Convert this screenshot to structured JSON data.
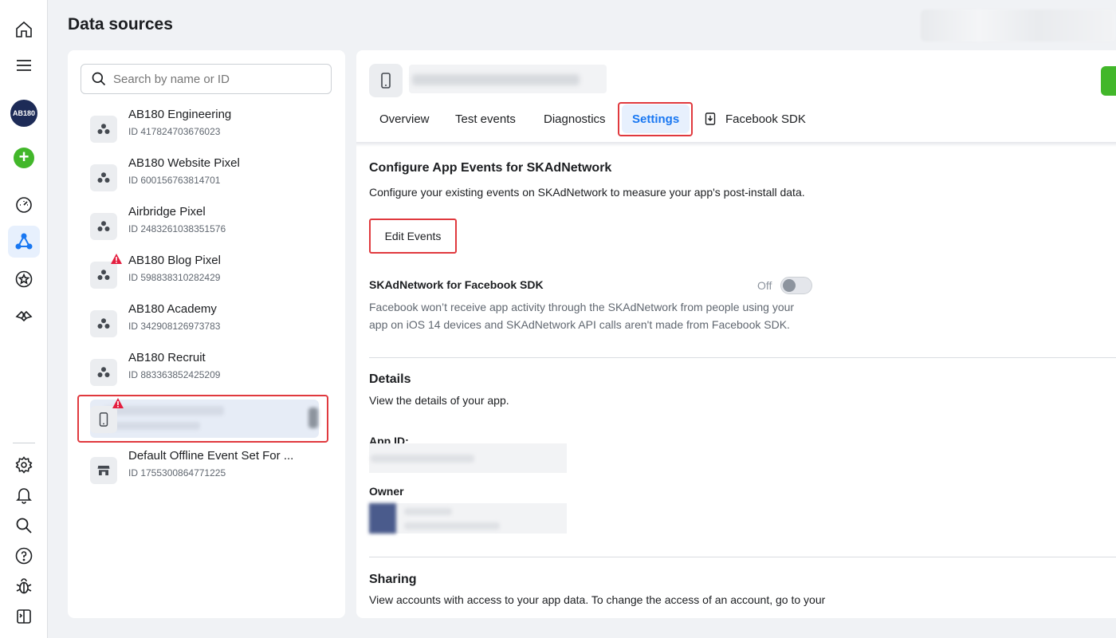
{
  "rail": {
    "avatar_text": "AB180",
    "icons": [
      "home-icon",
      "menu-icon",
      "add-icon",
      "dashboard-icon",
      "data-sources-icon",
      "star-icon",
      "partners-icon",
      "settings-icon",
      "bell-icon",
      "search-icon",
      "help-icon",
      "bug-icon",
      "panel-icon"
    ]
  },
  "header": {
    "title": "Data sources"
  },
  "search": {
    "placeholder": "Search by name or ID"
  },
  "sources": [
    {
      "name": "AB180 Engineering",
      "id": "ID 417824703676023",
      "icon": "pixel-icon",
      "warning": false
    },
    {
      "name": "AB180 Website Pixel",
      "id": "ID 600156763814701",
      "icon": "pixel-icon",
      "warning": false
    },
    {
      "name": "Airbridge Pixel",
      "id": "ID 2483261038351576",
      "icon": "pixel-icon",
      "warning": false
    },
    {
      "name": "AB180 Blog Pixel",
      "id": "ID 598838310282429",
      "icon": "pixel-icon",
      "warning": true
    },
    {
      "name": "AB180 Academy",
      "id": "ID 342908126973783",
      "icon": "pixel-icon",
      "warning": false
    },
    {
      "name": "AB180 Recruit",
      "id": "ID 883363852425209",
      "icon": "pixel-icon",
      "warning": false
    },
    {
      "name": "",
      "id": "",
      "icon": "mobile-icon",
      "warning": true,
      "selected": true
    },
    {
      "name": "Default Offline Event Set For ...",
      "id": "ID 1755300864771225",
      "icon": "store-icon",
      "warning": false
    }
  ],
  "tabs": [
    {
      "label": "Overview"
    },
    {
      "label": "Test events"
    },
    {
      "label": "Diagnostics"
    },
    {
      "label": "Settings",
      "active": true
    },
    {
      "label": "Facebook SDK"
    }
  ],
  "skad": {
    "title": "Configure App Events for SKAdNetwork",
    "description": "Configure your existing events on SKAdNetwork to measure your app's post-install data.",
    "edit_button": "Edit Events",
    "sdk_title": "SKAdNetwork for Facebook SDK",
    "toggle_state": "Off",
    "sdk_text_1": "Facebook won’t receive app activity through the SKAdNetwork from people using your",
    "sdk_text_2": "app on iOS 14 devices and SKAdNetwork API calls aren't made from Facebook SDK."
  },
  "details": {
    "title": "Details",
    "description": "View the details of your app.",
    "app_id_label": "App ID:",
    "owner_label": "Owner"
  },
  "sharing": {
    "title": "Sharing",
    "description": "View accounts with access to your app data. To change the access of an account, go to your"
  },
  "colors": {
    "accent": "#1877f2",
    "highlight": "#e0393e",
    "green": "#42b72a"
  }
}
